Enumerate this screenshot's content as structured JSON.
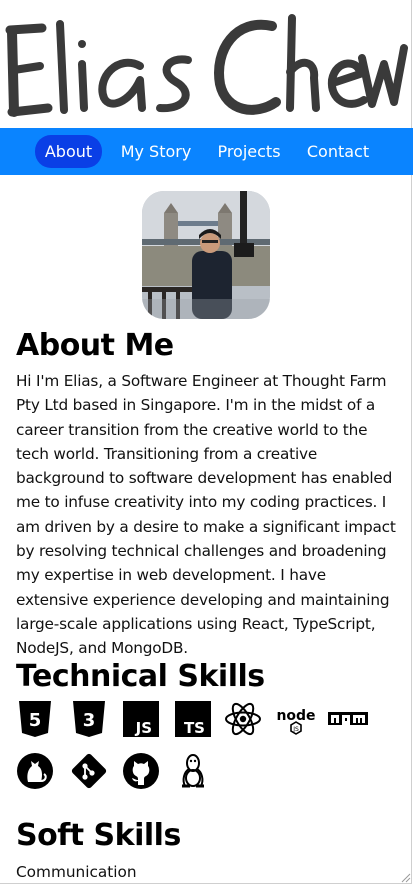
{
  "site": {
    "name": "Elias Chew"
  },
  "nav": {
    "items": [
      {
        "label": "About",
        "active": true
      },
      {
        "label": "My Story",
        "active": false
      },
      {
        "label": "Projects",
        "active": false
      },
      {
        "label": "Contact",
        "active": false
      }
    ],
    "accent": "#0a84ff",
    "active_bg": "#0a3fe6"
  },
  "about": {
    "heading": "About Me",
    "body": "Hi I'm Elias, a Software Engineer at Thought Farm Pty Ltd based in Singapore. I'm in the midst of a career transition from the creative world to the tech world. Transitioning from a creative background to software development has enabled me to infuse creativity into my coding practices. I am driven by a desire to make a significant impact by resolving technical challenges and broadening my expertise in web development. I have extensive experience developing and maintaining large-scale applications using React, TypeScript, NodeJS, and MongoDB."
  },
  "technical": {
    "heading": "Technical Skills",
    "icons": [
      "html5-icon",
      "css3-icon",
      "javascript-icon",
      "typescript-icon",
      "react-icon",
      "nodejs-icon",
      "npm-icon",
      "cat-icon",
      "git-icon",
      "github-icon",
      "linux-icon"
    ]
  },
  "soft": {
    "heading": "Soft Skills",
    "items": [
      "Communication"
    ]
  }
}
